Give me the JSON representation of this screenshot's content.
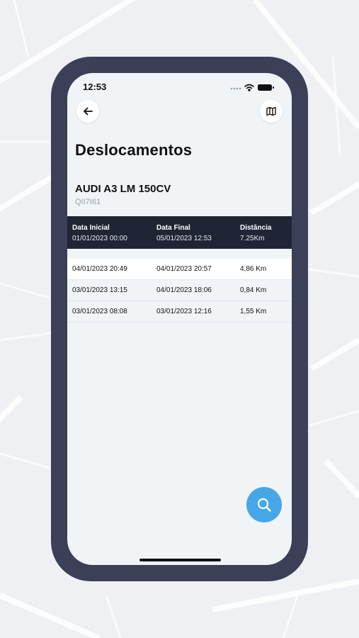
{
  "status_bar": {
    "time": "12:53"
  },
  "header": {
    "title": "Deslocamentos"
  },
  "vehicle": {
    "name": "AUDI A3 LM 150CV",
    "plate": "QII7I61"
  },
  "summary": {
    "headers": [
      "Data Inicial",
      "Data Final",
      "Distância"
    ],
    "values": [
      "01/01/2023 00:00",
      "05/01/2023 12:53",
      "7.25Km"
    ]
  },
  "trips": [
    {
      "start": "04/01/2023 20:49",
      "end": "04/01/2023 20:57",
      "distance": "4,86 Km"
    },
    {
      "start": "03/01/2023 13:15",
      "end": "04/01/2023 18:06",
      "distance": "0,84 Km"
    },
    {
      "start": "03/01/2023 08:08",
      "end": "03/01/2023 12:16",
      "distance": "1,55 Km"
    }
  ],
  "icons": {
    "back": "arrow-left-icon",
    "map": "map-icon",
    "search": "search-icon"
  },
  "colors": {
    "frame": "#3b3f58",
    "summary_bg": "#202536",
    "fab": "#47a7e6"
  }
}
